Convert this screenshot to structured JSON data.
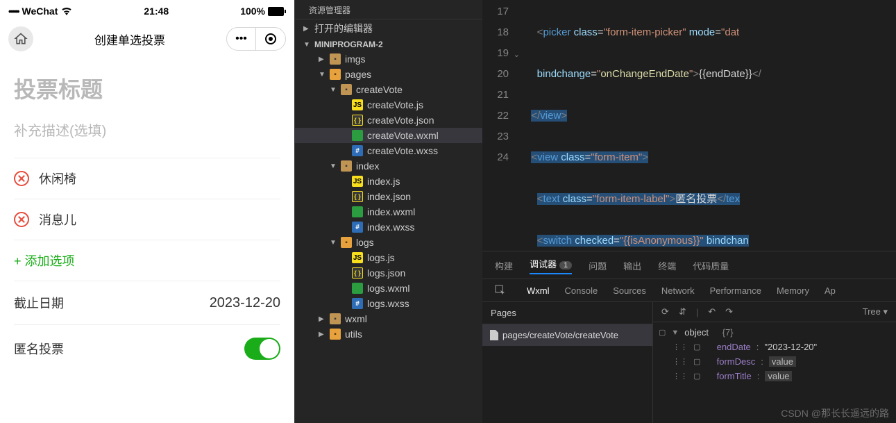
{
  "phone": {
    "status": {
      "carrier": "WeChat",
      "time": "21:48",
      "battery": "100%"
    },
    "nav": {
      "title": "创建单选投票"
    },
    "form": {
      "titlePlaceholder": "投票标题",
      "descPlaceholder": "补充描述(选填)",
      "options": [
        "休闲椅",
        "消息儿"
      ],
      "addOption": "+ 添加选项",
      "deadlineLabel": "截止日期",
      "deadlineValue": "2023-12-20",
      "anonymousLabel": "匿名投票"
    }
  },
  "explorer": {
    "title": "资源管理器",
    "openEditors": "打开的编辑器",
    "root": "MINIPROGRAM-2",
    "tree": [
      {
        "name": "imgs",
        "type": "folder",
        "depth": 1,
        "arrow": "▶"
      },
      {
        "name": "pages",
        "type": "folder-pages",
        "depth": 1,
        "arrow": "▼"
      },
      {
        "name": "createVote",
        "type": "folder",
        "depth": 2,
        "arrow": "▼"
      },
      {
        "name": "createVote.js",
        "type": "js",
        "depth": 3
      },
      {
        "name": "createVote.json",
        "type": "json",
        "depth": 3
      },
      {
        "name": "createVote.wxml",
        "type": "wxml",
        "depth": 3,
        "selected": true
      },
      {
        "name": "createVote.wxss",
        "type": "wxss",
        "depth": 3
      },
      {
        "name": "index",
        "type": "folder",
        "depth": 2,
        "arrow": "▼"
      },
      {
        "name": "index.js",
        "type": "js",
        "depth": 3
      },
      {
        "name": "index.json",
        "type": "json",
        "depth": 3
      },
      {
        "name": "index.wxml",
        "type": "wxml",
        "depth": 3
      },
      {
        "name": "index.wxss",
        "type": "wxss",
        "depth": 3
      },
      {
        "name": "logs",
        "type": "folder-pages",
        "depth": 2,
        "arrow": "▼"
      },
      {
        "name": "logs.js",
        "type": "js",
        "depth": 3
      },
      {
        "name": "logs.json",
        "type": "json",
        "depth": 3
      },
      {
        "name": "logs.wxml",
        "type": "wxml",
        "depth": 3
      },
      {
        "name": "logs.wxss",
        "type": "wxss",
        "depth": 3
      },
      {
        "name": "wxml",
        "type": "folder",
        "depth": 1,
        "arrow": "▶"
      },
      {
        "name": "utils",
        "type": "folder-pages",
        "depth": 1,
        "arrow": "▶"
      }
    ]
  },
  "code": {
    "lines": [
      17,
      18,
      19,
      20,
      21,
      22,
      23,
      24
    ]
  },
  "debugger": {
    "tabs1": {
      "build": "构建",
      "debug": "调试器",
      "badge": "1",
      "problems": "问题",
      "output": "输出",
      "terminal": "终端",
      "quality": "代码质量"
    },
    "tabs2": {
      "wxml": "Wxml",
      "console": "Console",
      "sources": "Sources",
      "network": "Network",
      "performance": "Performance",
      "memory": "Memory",
      "app": "Ap"
    },
    "pagesHeader": "Pages",
    "pagePath": "pages/createVote/createVote",
    "treeLabel": "Tree",
    "object": {
      "header": "object",
      "count": "{7}",
      "props": [
        {
          "key": "endDate",
          "val": "2023-12-20",
          "plain": true
        },
        {
          "key": "formDesc",
          "val": "value"
        },
        {
          "key": "formTitle",
          "val": "value"
        }
      ]
    }
  },
  "watermark": "CSDN @那长长遥远的路"
}
